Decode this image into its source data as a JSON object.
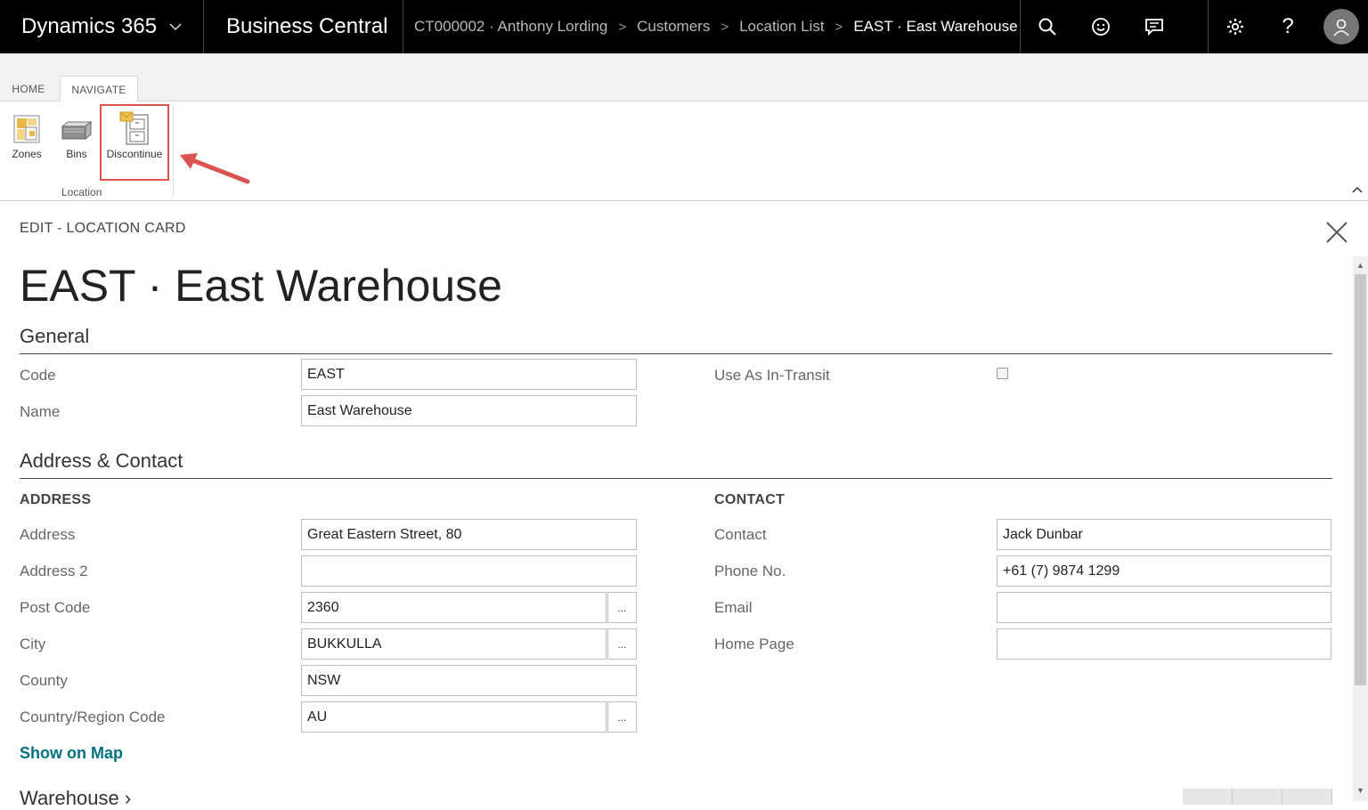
{
  "topbar": {
    "app_name": "Dynamics 365",
    "product": "Business Central",
    "breadcrumbs": [
      "CT000002 · Anthony Lording",
      "Customers",
      "Location List",
      "EAST · East Warehouse"
    ],
    "icons": [
      "search-icon",
      "smile-icon",
      "feedback-icon",
      "gear-icon",
      "help-icon",
      "user-avatar-icon"
    ],
    "help_glyph": "?"
  },
  "ribbon": {
    "tabs": [
      "HOME",
      "NAVIGATE"
    ],
    "active_tab": "NAVIGATE",
    "buttons": [
      "Zones",
      "Bins",
      "Discontinue"
    ],
    "group_label": "Location",
    "highlighted_button": "Discontinue",
    "highlight_color": "#d9534f"
  },
  "card": {
    "label": "EDIT - LOCATION CARD",
    "title": "EAST · East Warehouse",
    "general": {
      "title": "General",
      "code_label": "Code",
      "code_value": "EAST",
      "name_label": "Name",
      "name_value": "East Warehouse",
      "in_transit_label": "Use As In-Transit",
      "in_transit_checked": false
    },
    "address_contact": {
      "title": "Address & Contact",
      "address_head": "ADDRESS",
      "contact_head": "CONTACT",
      "address_label": "Address",
      "address_value": "Great Eastern Street, 80",
      "address2_label": "Address 2",
      "address2_value": "",
      "post_code_label": "Post Code",
      "post_code_value": "2360",
      "city_label": "City",
      "city_value": "BUKKULLA",
      "county_label": "County",
      "county_value": "NSW",
      "country_label": "Country/Region Code",
      "country_value": "AU",
      "contact_label": "Contact",
      "contact_value": "Jack Dunbar",
      "phone_label": "Phone No.",
      "phone_value": "+61 (7) 9874 1299",
      "email_label": "Email",
      "email_value": "",
      "homepage_label": "Home Page",
      "homepage_value": "",
      "lookup_glyph": "...",
      "show_on_map": "Show on Map"
    },
    "warehouse_title": "Warehouse"
  },
  "colors": {
    "topbar_bg": "#000000",
    "link": "#00707e",
    "zones_icon": "#e8b84a",
    "discontinue_envelope": "#f0c04a"
  }
}
